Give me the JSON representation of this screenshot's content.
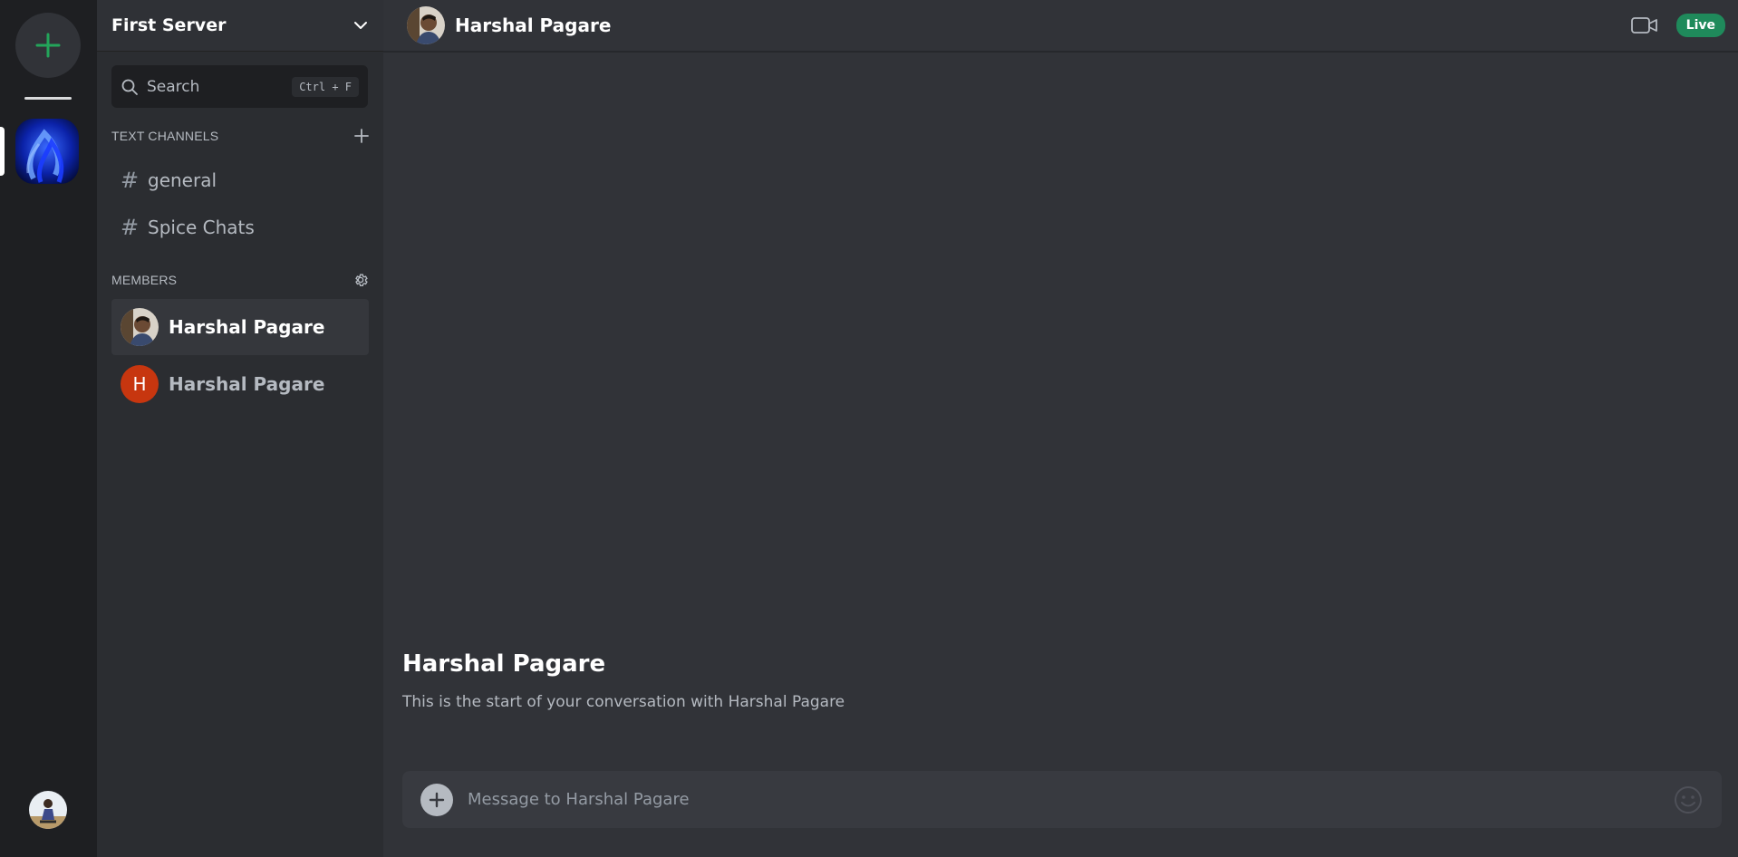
{
  "server": {
    "name": "First Server"
  },
  "search": {
    "label": "Search",
    "shortcut": "Ctrl + F"
  },
  "sections": {
    "text_channels": "TEXT CHANNELS",
    "members": "MEMBERS"
  },
  "channels": [
    {
      "label": "general"
    },
    {
      "label": "Spice Chats"
    }
  ],
  "members": [
    {
      "name": "Harshal Pagare",
      "avatar": "photo",
      "active": true
    },
    {
      "name": "Harshal Pagare",
      "avatar_initial": "H",
      "avatar_color": "#c7360f",
      "active": false
    }
  ],
  "header": {
    "name": "Harshal Pagare",
    "live_label": "Live"
  },
  "intro": {
    "title": "Harshal Pagare",
    "subtitle": "This is the start of your conversation with Harshal Pagare"
  },
  "composer": {
    "placeholder": "Message to Harshal Pagare"
  },
  "colors": {
    "accent_green": "#23a55a",
    "live_badge": "#1f8a5b",
    "avatar_orange": "#c7360f"
  },
  "icons": [
    "plus-icon",
    "search-icon",
    "chevron-down-icon",
    "hash-icon",
    "gear-icon",
    "video-camera-icon",
    "emoji-icon"
  ]
}
